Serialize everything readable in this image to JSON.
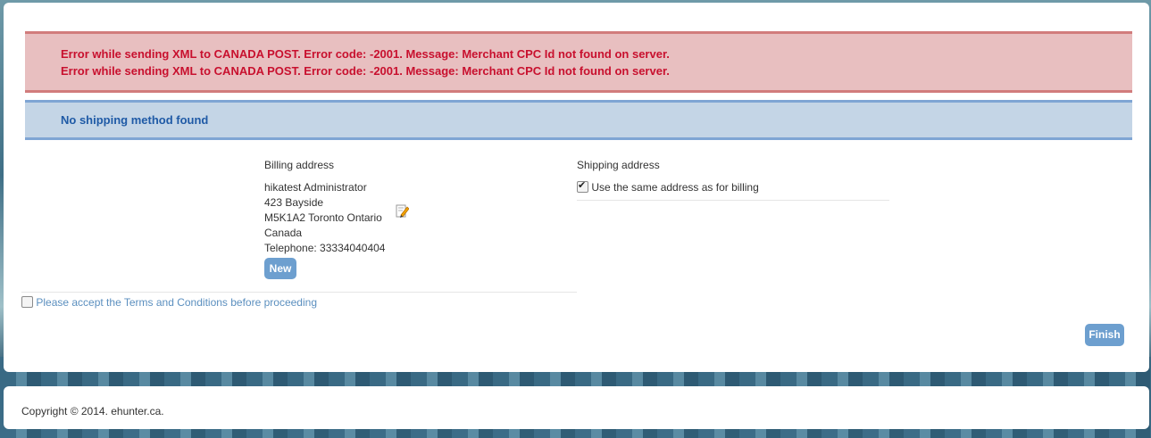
{
  "messages": {
    "errors": [
      "Error while sending XML to CANADA POST. Error code: -2001. Message: Merchant CPC Id not found on server.",
      "Error while sending XML to CANADA POST. Error code: -2001. Message: Merchant CPC Id not found on server."
    ],
    "info": "No shipping method found"
  },
  "billing": {
    "title": "Billing address",
    "lines": [
      "hikatest Administrator",
      "423 Bayside",
      "M5K1A2 Toronto Ontario",
      "Canada",
      "Telephone: 33334040404"
    ],
    "edit_icon": "edit-pencil-icon",
    "new_label": "New"
  },
  "shipping": {
    "title": "Shipping address",
    "same_as_billing_label": "Use the same address as for billing",
    "same_as_billing_checked": true
  },
  "terms": {
    "label": "Please accept the Terms and Conditions before proceeding",
    "checked": false
  },
  "actions": {
    "finish_label": "Finish"
  },
  "footer": {
    "copyright": "Copyright © 2014. ehunter.ca."
  },
  "colors": {
    "error_bg": "#e8bfc0",
    "error_text": "#c8102e",
    "info_bg": "#c4d5e6",
    "info_text": "#1f5aa6",
    "button": "#6d9fcf",
    "link": "#5b8fbf"
  }
}
